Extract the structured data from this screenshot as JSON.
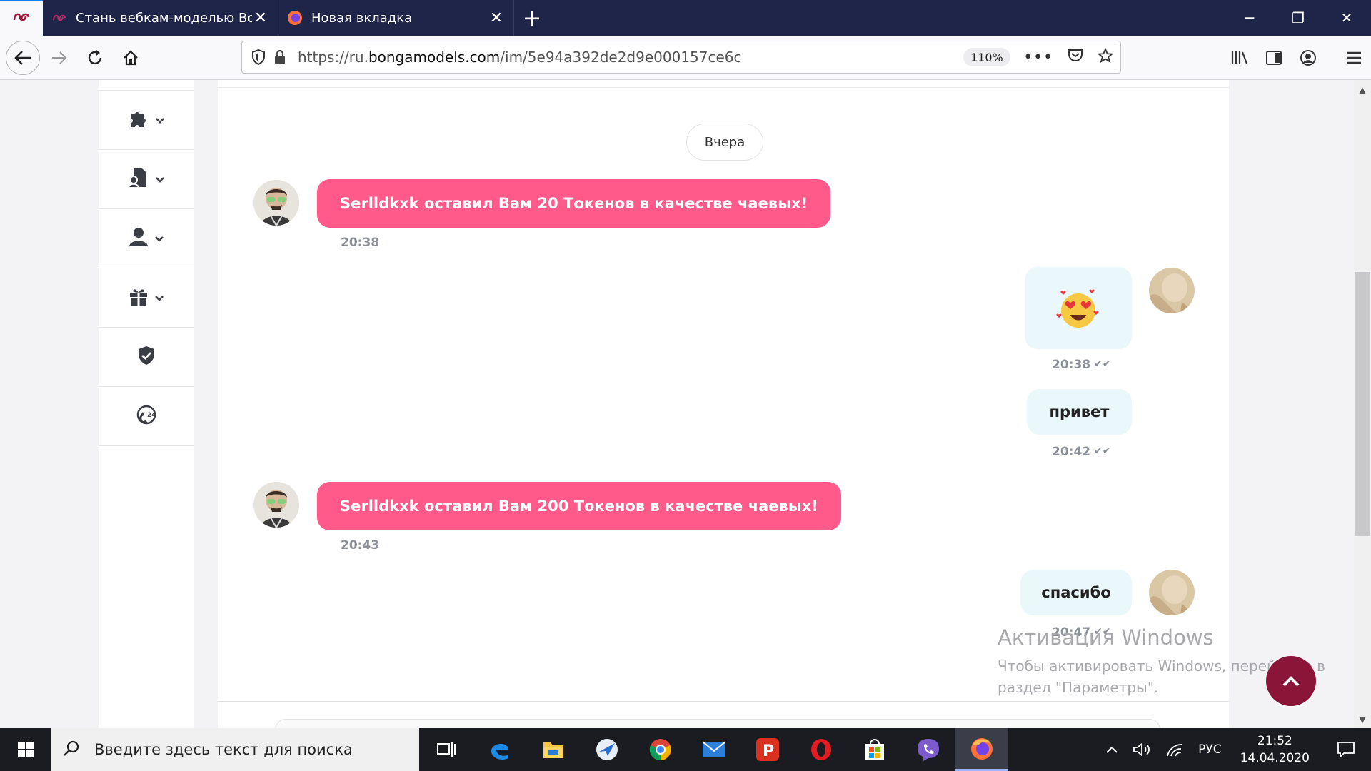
{
  "browser": {
    "tabs": [
      {
        "label": "Стань вебкам-моделью Bonga"
      },
      {
        "label": "Новая вкладка"
      }
    ],
    "url_prefix": "https://ru.",
    "url_domain": "bongamodels.com",
    "url_path": "/im/5e94a392de2d9e000157ce6c",
    "zoom": "110%"
  },
  "chat": {
    "date_separator": "Вчера",
    "messages": [
      {
        "direction": "in",
        "type": "tip",
        "text": "Serlldkxk оставил Вам 20 Токенов в качестве чаевых!",
        "time": "20:38"
      },
      {
        "direction": "out",
        "type": "emoji",
        "text": "😍",
        "time": "20:38",
        "read": true
      },
      {
        "direction": "out",
        "type": "text",
        "text": "привет",
        "time": "20:42",
        "read": true
      },
      {
        "direction": "in",
        "type": "tip",
        "text": "Serlldkxk оставил Вам 200 Токенов в качестве чаевых!",
        "time": "20:43"
      },
      {
        "direction": "out",
        "type": "text",
        "text": "спасибо",
        "time": "20:47",
        "read": true
      }
    ]
  },
  "watermark": {
    "title": "Активация Windows",
    "line1": "Чтобы активировать Windows, перейдите в",
    "line2": "раздел \"Параметры\"."
  },
  "taskbar": {
    "search_placeholder": "Введите здесь текст для поиска",
    "language": "РУС",
    "time": "21:52",
    "date": "14.04.2020"
  },
  "colors": {
    "tip_bubble": "#ff5a8a",
    "out_bubble": "#eaf7fb",
    "scroll_button": "#8a1538",
    "tabbar": "#1f2548"
  }
}
